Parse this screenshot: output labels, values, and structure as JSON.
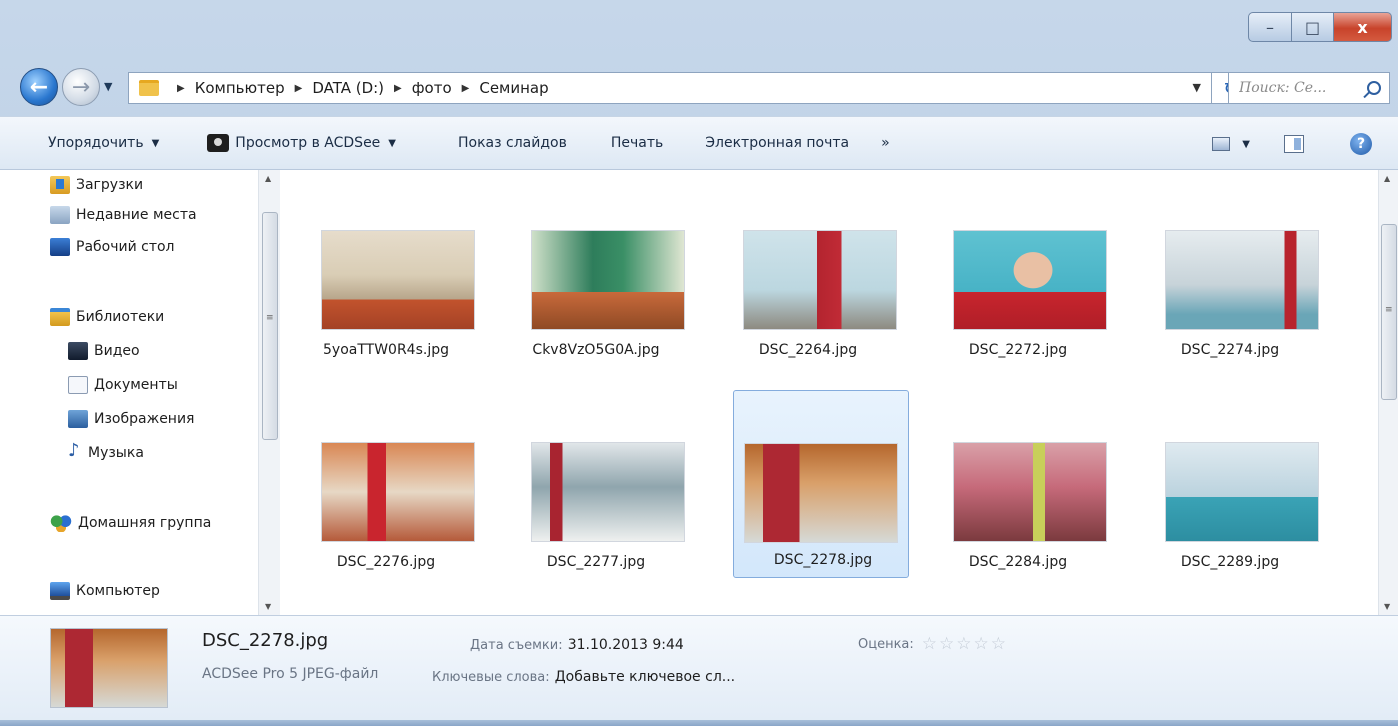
{
  "window": {
    "minimize_glyph": "–",
    "maximize_glyph": "□",
    "close_glyph": "x"
  },
  "nav": {
    "back_glyph": "←",
    "forward_glyph": "→",
    "history_glyph": "▼",
    "breadcrumb": [
      "Компьютер",
      "DATA (D:)",
      "фото",
      "Семинар"
    ],
    "refresh_glyph": "↻",
    "search_placeholder": "Поиск: Се...",
    "dropdown_glyph": "▼"
  },
  "toolbar": {
    "organize": "Упорядочить",
    "acdsee": "Просмотр в ACDSee",
    "slideshow": "Показ слайдов",
    "print": "Печать",
    "email": "Электронная почта",
    "more": "»",
    "arrow_glyph": "▼",
    "help_glyph": "?"
  },
  "navpane": {
    "items": [
      {
        "label": "Загрузки",
        "icon": "downloads-icon"
      },
      {
        "label": "Недавние места",
        "icon": "recent-places-icon"
      },
      {
        "label": "Рабочий стол",
        "icon": "desktop-icon"
      },
      {
        "label": "Библиотеки",
        "icon": "libraries-icon"
      },
      {
        "label": "Видео",
        "icon": "video-icon"
      },
      {
        "label": "Документы",
        "icon": "documents-icon"
      },
      {
        "label": "Изображения",
        "icon": "images-icon"
      },
      {
        "label": "Музыка",
        "icon": "music-icon"
      },
      {
        "label": "Домашняя группа",
        "icon": "homegroup-icon"
      },
      {
        "label": "Компьютер",
        "icon": "computer-icon"
      }
    ],
    "scroll_up": "▲",
    "scroll_down": "▼"
  },
  "files": [
    {
      "name": "5yoaTTW0R4s.jpg",
      "selected": false
    },
    {
      "name": "Ckv8VzO5G0A.jpg",
      "selected": false
    },
    {
      "name": "DSC_2264.jpg",
      "selected": false
    },
    {
      "name": "DSC_2272.jpg",
      "selected": false
    },
    {
      "name": "DSC_2274.jpg",
      "selected": false
    },
    {
      "name": "DSC_2276.jpg",
      "selected": false
    },
    {
      "name": "DSC_2277.jpg",
      "selected": false
    },
    {
      "name": "DSC_2278.jpg",
      "selected": true
    },
    {
      "name": "DSC_2284.jpg",
      "selected": false
    },
    {
      "name": "DSC_2289.jpg",
      "selected": false
    }
  ],
  "details": {
    "name": "DSC_2278.jpg",
    "type": "ACDSee Pro 5 JPEG-файл",
    "date_label": "Дата съемки:",
    "date_value": "31.10.2013 9:44",
    "rating_label": "Оценка:",
    "rating": 0,
    "rating_max": 5,
    "keywords_label": "Ключевые слова:",
    "keywords_value": "Добавьте ключевое сл..."
  },
  "colors": {
    "selection_bg": "#d3e7fb",
    "selection_border": "#84acdd",
    "frame": "#b9cde4"
  }
}
